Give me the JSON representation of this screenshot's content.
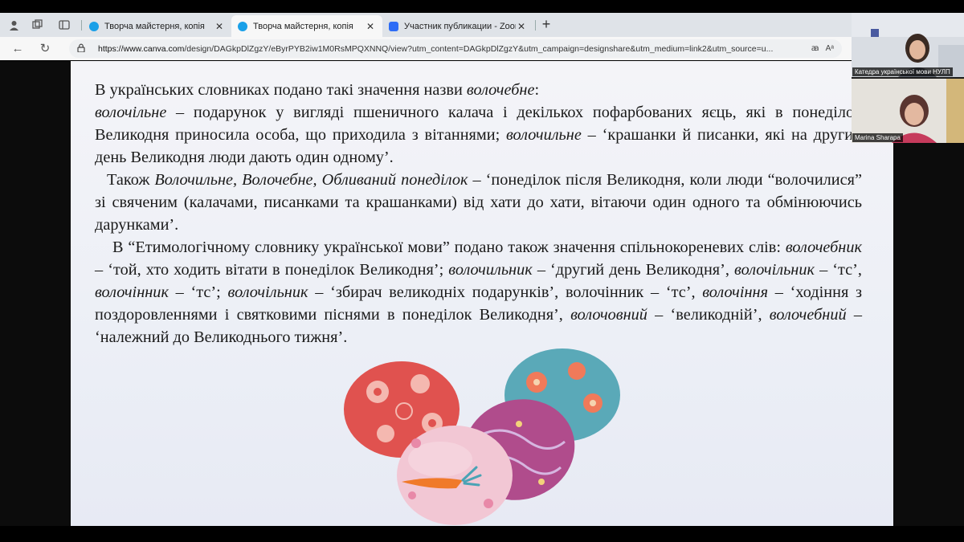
{
  "browser": {
    "tabs": [
      {
        "title": "Творча майстерня, копія",
        "active": false,
        "favicon_color": "#1aa0e8"
      },
      {
        "title": "Творча майстерня, копія",
        "active": true,
        "favicon_color": "#1aa0e8"
      },
      {
        "title": "Участник публикации - Zoom",
        "active": false,
        "favicon_color": "#2d6cf6"
      }
    ],
    "url_host": "https://www.canva.com",
    "url_rest": "/design/DAGkpDlZgzY/eByrPYB2iw1M0RsMPQXNNQ/view?utm_content=DAGkpDlZgzY&utm_campaign=designshare&utm_medium=link2&utm_source=u...",
    "read_aloud": "Aᵃ",
    "translate": "ꜳ"
  },
  "slide": {
    "p1_a": "В українських словниках подано такі значення назви ",
    "p1_i": "волочебне",
    "p1_b": ":",
    "p2_i1": "волочільне",
    "p2_a": " – подарунок у вигляді пшеничного калача і декількох пофарбованих яєць, які в понеділок Великодня приносила особа, що приходила з вітаннями; ",
    "p2_i2": "волочильне",
    "p2_b": " – ‘крашанки й писанки, які на другий день Великодня люди дають один одному’.",
    "p3_a": "Також ",
    "p3_i": "Волочильне, Волочебне, Обливаний понеділок",
    "p3_b": " – ‘понеділок після Великодня, коли люди “волочилися” зі свяченим (калачами, писанками та крашанками) від хати до хати, вітаючи один одного та обмінюючись дарунками’.",
    "p4_a": "В “Етимологічному словнику української мови” подано також значення спільнокореневих слів: ",
    "p4_i1": "волочебник",
    "p4_b": " – ‘той, хто ходить вітати в понеділок Великодня’; ",
    "p4_i2": "волочильник",
    "p4_c": " – ‘другий день Великодня’, ",
    "p4_i3": "волочільник",
    "p4_d": " – ‘тс’, ",
    "p4_i4": "волочінник",
    "p4_e": " – ‘тс’; ",
    "p4_i5": "волочільник",
    "p4_f": " – ‘збирач великодніх подарунків’, волочінник – ‘тс’, ",
    "p4_i6": "волочіння",
    "p4_g": " – ‘ходіння з поздоровленнями і святковими піснями в понеділок Великодня’, ",
    "p4_i7": "волочовний",
    "p4_h": " – ‘великодній’, ",
    "p4_i8": "волочебний",
    "p4_j": " – ‘належний до Великоднього тижня’."
  },
  "zoom": {
    "participants": [
      {
        "name": "Катедра української мови НУЛП"
      },
      {
        "name": "Marina Sharapa"
      }
    ]
  },
  "colors": {
    "egg_red": "#e0524f",
    "egg_teal": "#5aa9b8",
    "egg_purple": "#b04c8c",
    "egg_pink": "#f2c7d4",
    "carrot": "#f07a2a"
  }
}
